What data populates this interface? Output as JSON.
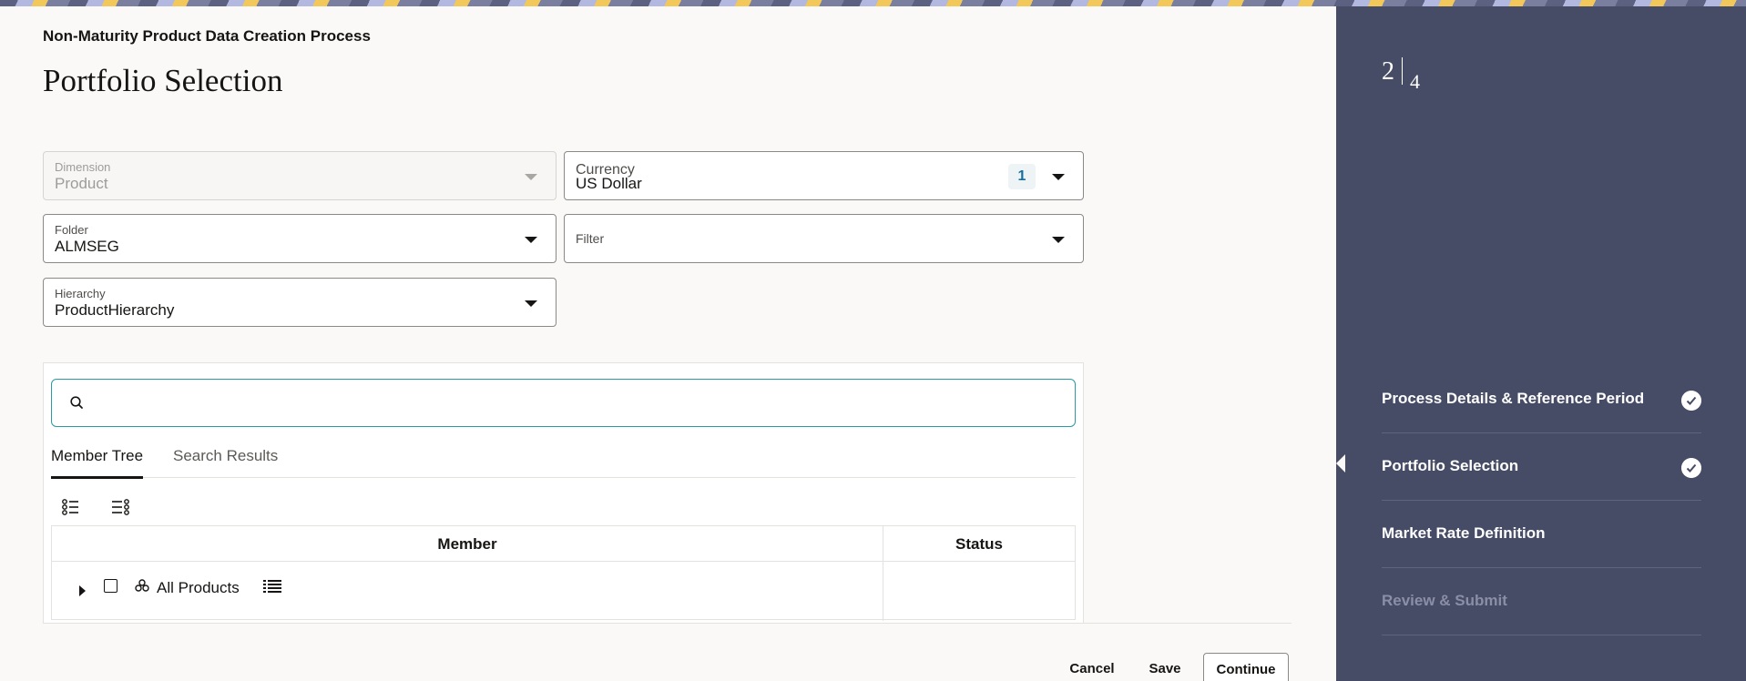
{
  "header": {
    "process_title": "Non-Maturity Product Data Creation Process",
    "page_title": "Portfolio Selection"
  },
  "fields": {
    "dimension": {
      "label": "Dimension",
      "value": "Product",
      "disabled": true
    },
    "currency": {
      "label": "Currency",
      "value": "US Dollar",
      "badge": "1"
    },
    "folder": {
      "label": "Folder",
      "value": "ALMSEG"
    },
    "filter": {
      "label": "Filter",
      "value": ""
    },
    "hierarchy": {
      "label": "Hierarchy",
      "value": "ProductHierarchy"
    }
  },
  "search": {
    "placeholder": "",
    "value": "",
    "icon": "search-icon"
  },
  "tabs": [
    {
      "label": "Member Tree",
      "active": true
    },
    {
      "label": "Search Results",
      "active": false
    }
  ],
  "toolbar": {
    "icons": [
      "expand-list-icon",
      "collapse-list-icon"
    ]
  },
  "grid": {
    "columns": [
      "Member",
      "Status"
    ],
    "rows": [
      {
        "member": "All Products",
        "status": "",
        "expandable": true,
        "checked": false
      }
    ]
  },
  "footer": {
    "cancel_label": "Cancel",
    "save_label": "Save",
    "continue_label": "Continue"
  },
  "train": {
    "current_step": "2",
    "total_steps": "4",
    "steps": [
      {
        "label": "Process Details & Reference Period",
        "state": "complete"
      },
      {
        "label": "Portfolio Selection",
        "state": "current-complete"
      },
      {
        "label": "Market Rate Definition",
        "state": "enabled"
      },
      {
        "label": "Review & Submit",
        "state": "disabled"
      }
    ]
  },
  "colors": {
    "train_background": "#474c66",
    "search_focus_border": "#2a9aa6",
    "badge_text": "#166f9e"
  }
}
